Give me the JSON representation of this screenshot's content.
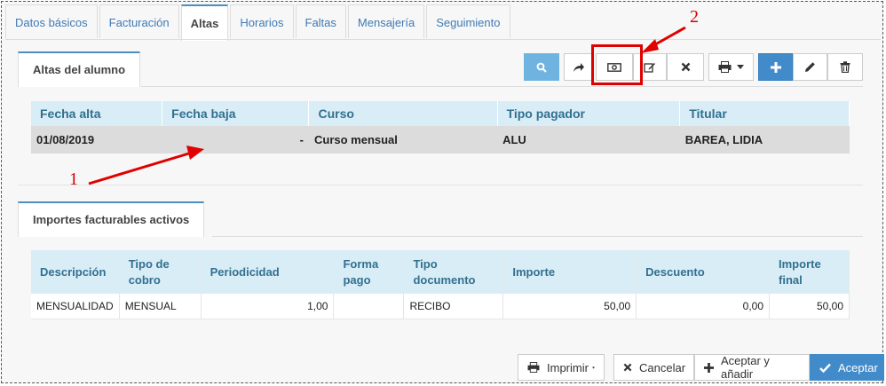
{
  "tabs": [
    {
      "label": "Datos básicos"
    },
    {
      "label": "Facturación"
    },
    {
      "label": "Altas"
    },
    {
      "label": "Horarios"
    },
    {
      "label": "Faltas"
    },
    {
      "label": "Mensajería"
    },
    {
      "label": "Seguimiento"
    }
  ],
  "active_tab": "Altas",
  "altas": {
    "title": "Altas del alumno",
    "headers": [
      "Fecha alta",
      "Fecha baja",
      "Curso",
      "Tipo pagador",
      "Titular"
    ],
    "rows": [
      [
        "01/08/2019",
        "-",
        "Curso mensual",
        "ALU",
        "BAREA, LIDIA"
      ]
    ]
  },
  "importes": {
    "title": "Importes facturables activos",
    "headers": [
      "Descripción",
      "Tipo de cobro",
      "Periodicidad",
      "Forma pago",
      "Tipo documento",
      "Importe",
      "Descuento",
      "Importe final"
    ],
    "rows": [
      [
        "MENSUALIDAD",
        "MENSUAL",
        "1,00",
        "",
        "RECIBO",
        "50,00",
        "0,00",
        "50,00"
      ]
    ]
  },
  "toolbar_icons": [
    "search-icon",
    "share-icon",
    "money-icon",
    "edit-icon",
    "close-icon",
    "print-icon",
    "plus-icon",
    "pencil-icon",
    "trash-icon"
  ],
  "footer": {
    "print_label": "Imprimir",
    "cancel_label": "Cancelar",
    "accept_add_label": "Aceptar y añadir",
    "accept_label": "Aceptar"
  },
  "annotations": {
    "label_1": "1",
    "label_2": "2",
    "color": "#e00000"
  },
  "colors": {
    "accent": "#4c8fbd",
    "header_bg": "#d9edf7",
    "header_text": "#31708f",
    "primary": "#428bca"
  }
}
